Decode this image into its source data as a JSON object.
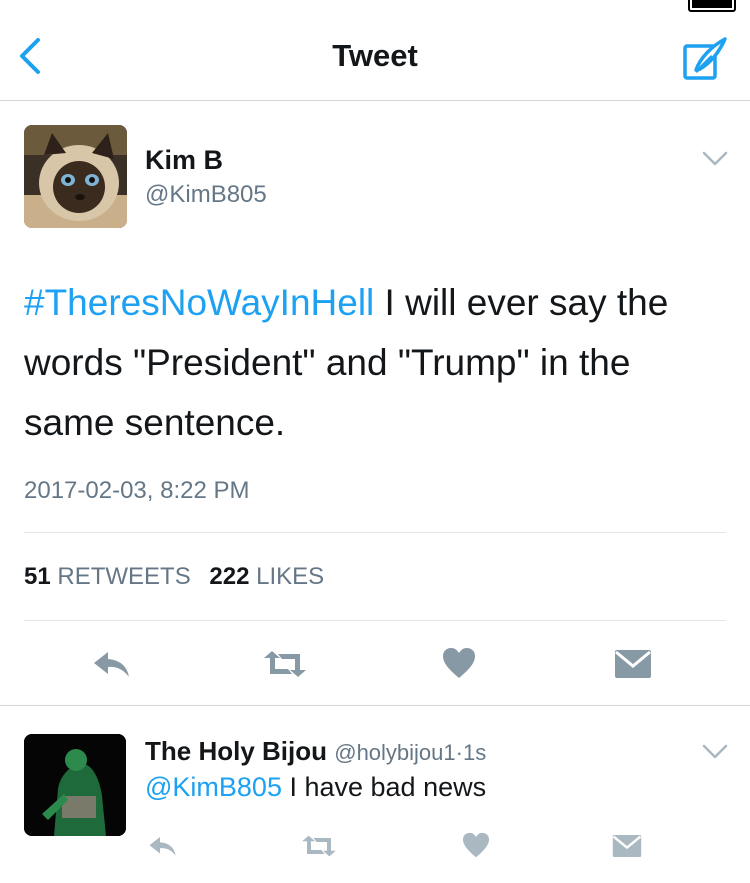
{
  "nav": {
    "title": "Tweet"
  },
  "tweet": {
    "author_name": "Kim B",
    "author_handle": "@KimB805",
    "hashtag": "#TheresNoWayInHell",
    "body": " I will ever say the words \"President\" and \"Trump\" in the same sentence.",
    "timestamp": "2017-02-03, 8:22 PM",
    "retweets_count": "51",
    "retweets_label": "RETWEETS",
    "likes_count": "222",
    "likes_label": "LIKES"
  },
  "reply": {
    "author_name": "The Holy Bijou",
    "author_handle": "@holybijou1",
    "separator": "·",
    "time": "1s",
    "mention": "@KimB805",
    "body": " I have bad news"
  },
  "icons": {
    "back": "chevron-left-icon",
    "compose": "compose-icon",
    "more": "chevron-down-icon",
    "reply": "reply-icon",
    "retweet": "retweet-icon",
    "like": "heart-icon",
    "dm": "envelope-icon"
  },
  "colors": {
    "accent": "#1da1f2",
    "secondary": "#657786",
    "icon": "#8899a6",
    "text": "#14171a"
  }
}
